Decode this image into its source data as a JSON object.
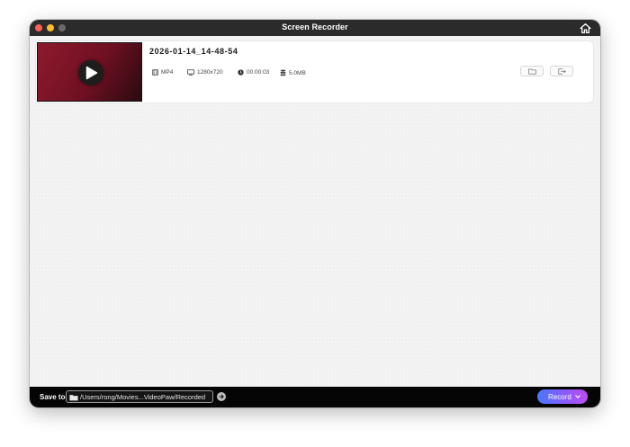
{
  "window": {
    "title": "Screen Recorder"
  },
  "recordings": [
    {
      "filename": "2026-01-14_14-48-54",
      "format": "MP4",
      "resolution": "1280x720",
      "duration": "00:00:03",
      "size": "5.0MB"
    }
  ],
  "bottom_bar": {
    "save_to_label": "Save to",
    "path": "/Users/rong/Movies...VideoPaw/Recorded",
    "record_label": "Record"
  },
  "colors": {
    "titlebar": "#2b2b2b",
    "bottombar": "#050505",
    "record_gradient_start": "#4a76ff",
    "record_gradient_end": "#c04cf0"
  },
  "icons": {
    "home": "home-icon",
    "play": "play-icon",
    "format": "film-icon",
    "resolution": "monitor-icon",
    "duration": "clock-icon",
    "size": "database-icon",
    "open_folder": "folder-icon",
    "export": "export-icon",
    "path_folder": "folder-icon",
    "path_go": "arrow-right-icon",
    "record_menu": "chevron-down-icon"
  }
}
